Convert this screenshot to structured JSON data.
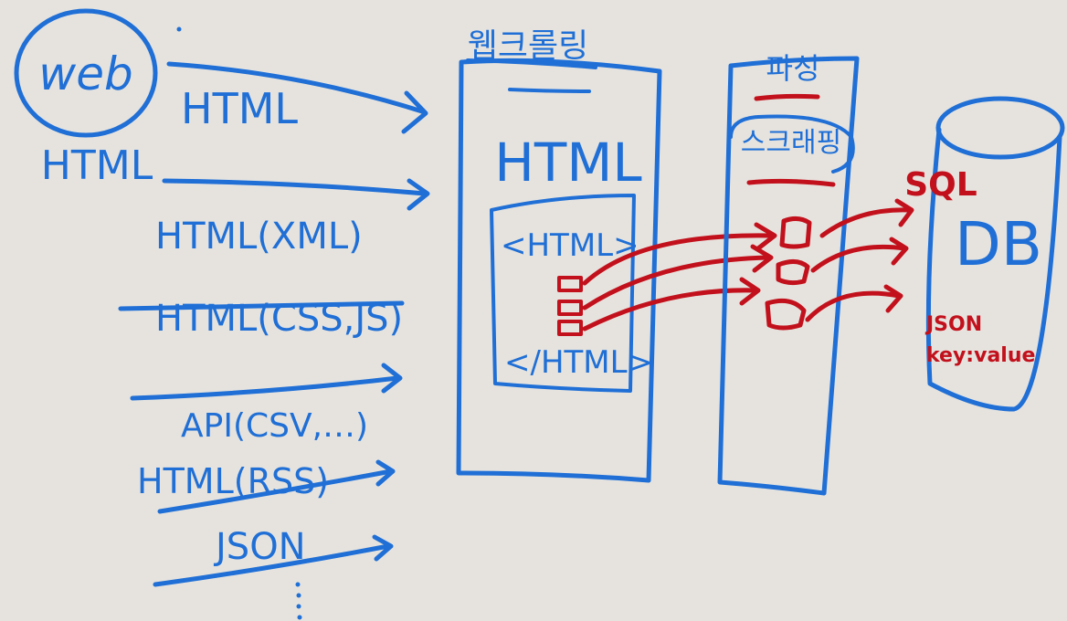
{
  "web": {
    "bubble": "web",
    "caption": "HTML"
  },
  "left_labels": {
    "html": "HTML",
    "html_xml": "HTML(XML)",
    "html_css_js": "HTML(CSS,JS)",
    "api": "API(CSV,…)",
    "html_rss": "HTML(RSS)",
    "json": "JSON"
  },
  "crawler": {
    "title": "웹크롤링",
    "big_label": "HTML",
    "inner_open": "<HTML>",
    "inner_close": "</HTML>"
  },
  "parser": {
    "title": "파싱",
    "subtitle": "스크래핑"
  },
  "database": {
    "label": "DB",
    "query_label": "SQL",
    "format_line1": "JSON",
    "format_line2": "key:value"
  },
  "colors": {
    "ink_blue": "#1f6fd6",
    "ink_red": "#c2111c",
    "board": "#e6e3de"
  }
}
